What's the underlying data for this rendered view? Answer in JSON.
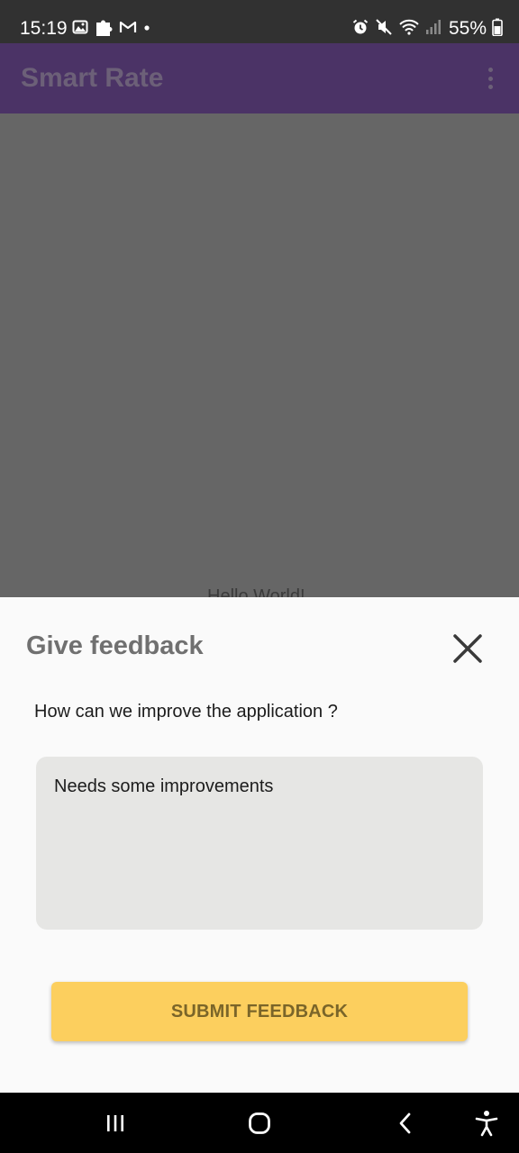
{
  "status_bar": {
    "time": "15:19",
    "battery": "55%",
    "left_icons": [
      "gallery-icon",
      "puzzle-icon",
      "gmail-icon",
      "dot-icon"
    ],
    "right_icons": [
      "alarm-icon",
      "mute-icon",
      "wifi-icon",
      "signal-icon",
      "battery-icon"
    ]
  },
  "app_bar": {
    "title": "Smart Rate",
    "menu_icon": "more-vert-icon"
  },
  "background": {
    "text": "Hello World!"
  },
  "feedback_sheet": {
    "title": "Give feedback",
    "question": "How can we improve the application ?",
    "input_value": "Needs some improvements",
    "submit_label": "SUBMIT FEEDBACK",
    "close_icon": "close-icon"
  },
  "nav_bar": {
    "icons": [
      "recents-icon",
      "home-icon",
      "back-icon",
      "accessibility-icon"
    ]
  },
  "colors": {
    "app_bar": "#4b3366",
    "scrim": "#666666",
    "sheet": "#fafafa",
    "input_bg": "#e6e6e4",
    "submit_button": "#fccf5e"
  }
}
